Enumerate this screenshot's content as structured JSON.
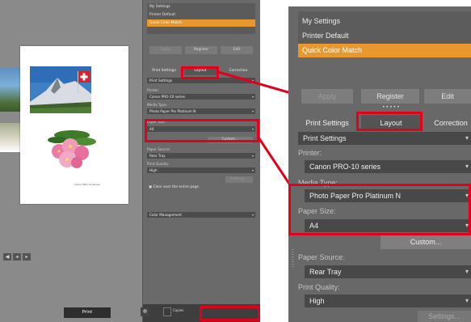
{
  "left": {
    "photo_caption": "Canon PRO-10 series",
    "list": [
      "My Settings",
      "Printer Default",
      "Quick Color Match"
    ],
    "buttons": {
      "apply": "Apply",
      "register": "Register",
      "edit": "Edit"
    },
    "tabs": {
      "print_settings": "Print Settings",
      "layout": "Layout",
      "correction": "Correction"
    },
    "print_settings_value": "Print Settings",
    "printer_label": "Printer:",
    "printer_value": "Canon PRO-10 series",
    "media_label": "Media Type:",
    "media_value": "Photo Paper Pro Platinum N",
    "paper_size_label": "Paper Size:",
    "paper_size_value": "A4",
    "custom_button": "Custom...",
    "source_label": "Paper Source:",
    "source_value": "Rear Tray",
    "quality_label": "Print Quality:",
    "quality_value": "High",
    "settings_button": "Settings...",
    "clear_check": "Clear over the entire page",
    "color_mgmt": "Color Management",
    "copies_label": "Copies",
    "print_button": "Print"
  },
  "zoom": {
    "list": [
      "My Settings",
      "Printer Default",
      "Quick Color Match"
    ],
    "buttons": {
      "apply": "Apply",
      "register": "Register",
      "edit": "Edit"
    },
    "tabs": {
      "print_settings": "Print Settings",
      "layout": "Layout",
      "correction": "Correction"
    },
    "print_settings_value": "Print Settings",
    "printer_label": "Printer:",
    "printer_value": "Canon PRO-10 series",
    "media_label": "Media Type:",
    "media_value": "Photo Paper Pro Platinum N",
    "paper_size_label": "Paper Size:",
    "paper_size_value": "A4",
    "custom_button": "Custom...",
    "source_label": "Paper Source:",
    "source_value": "Rear Tray",
    "quality_label": "Print Quality:",
    "quality_value": "High",
    "settings_button": "Settings..."
  },
  "colors": {
    "highlight": "#e3001b",
    "selection": "#e8982d",
    "panel": "#686868"
  }
}
